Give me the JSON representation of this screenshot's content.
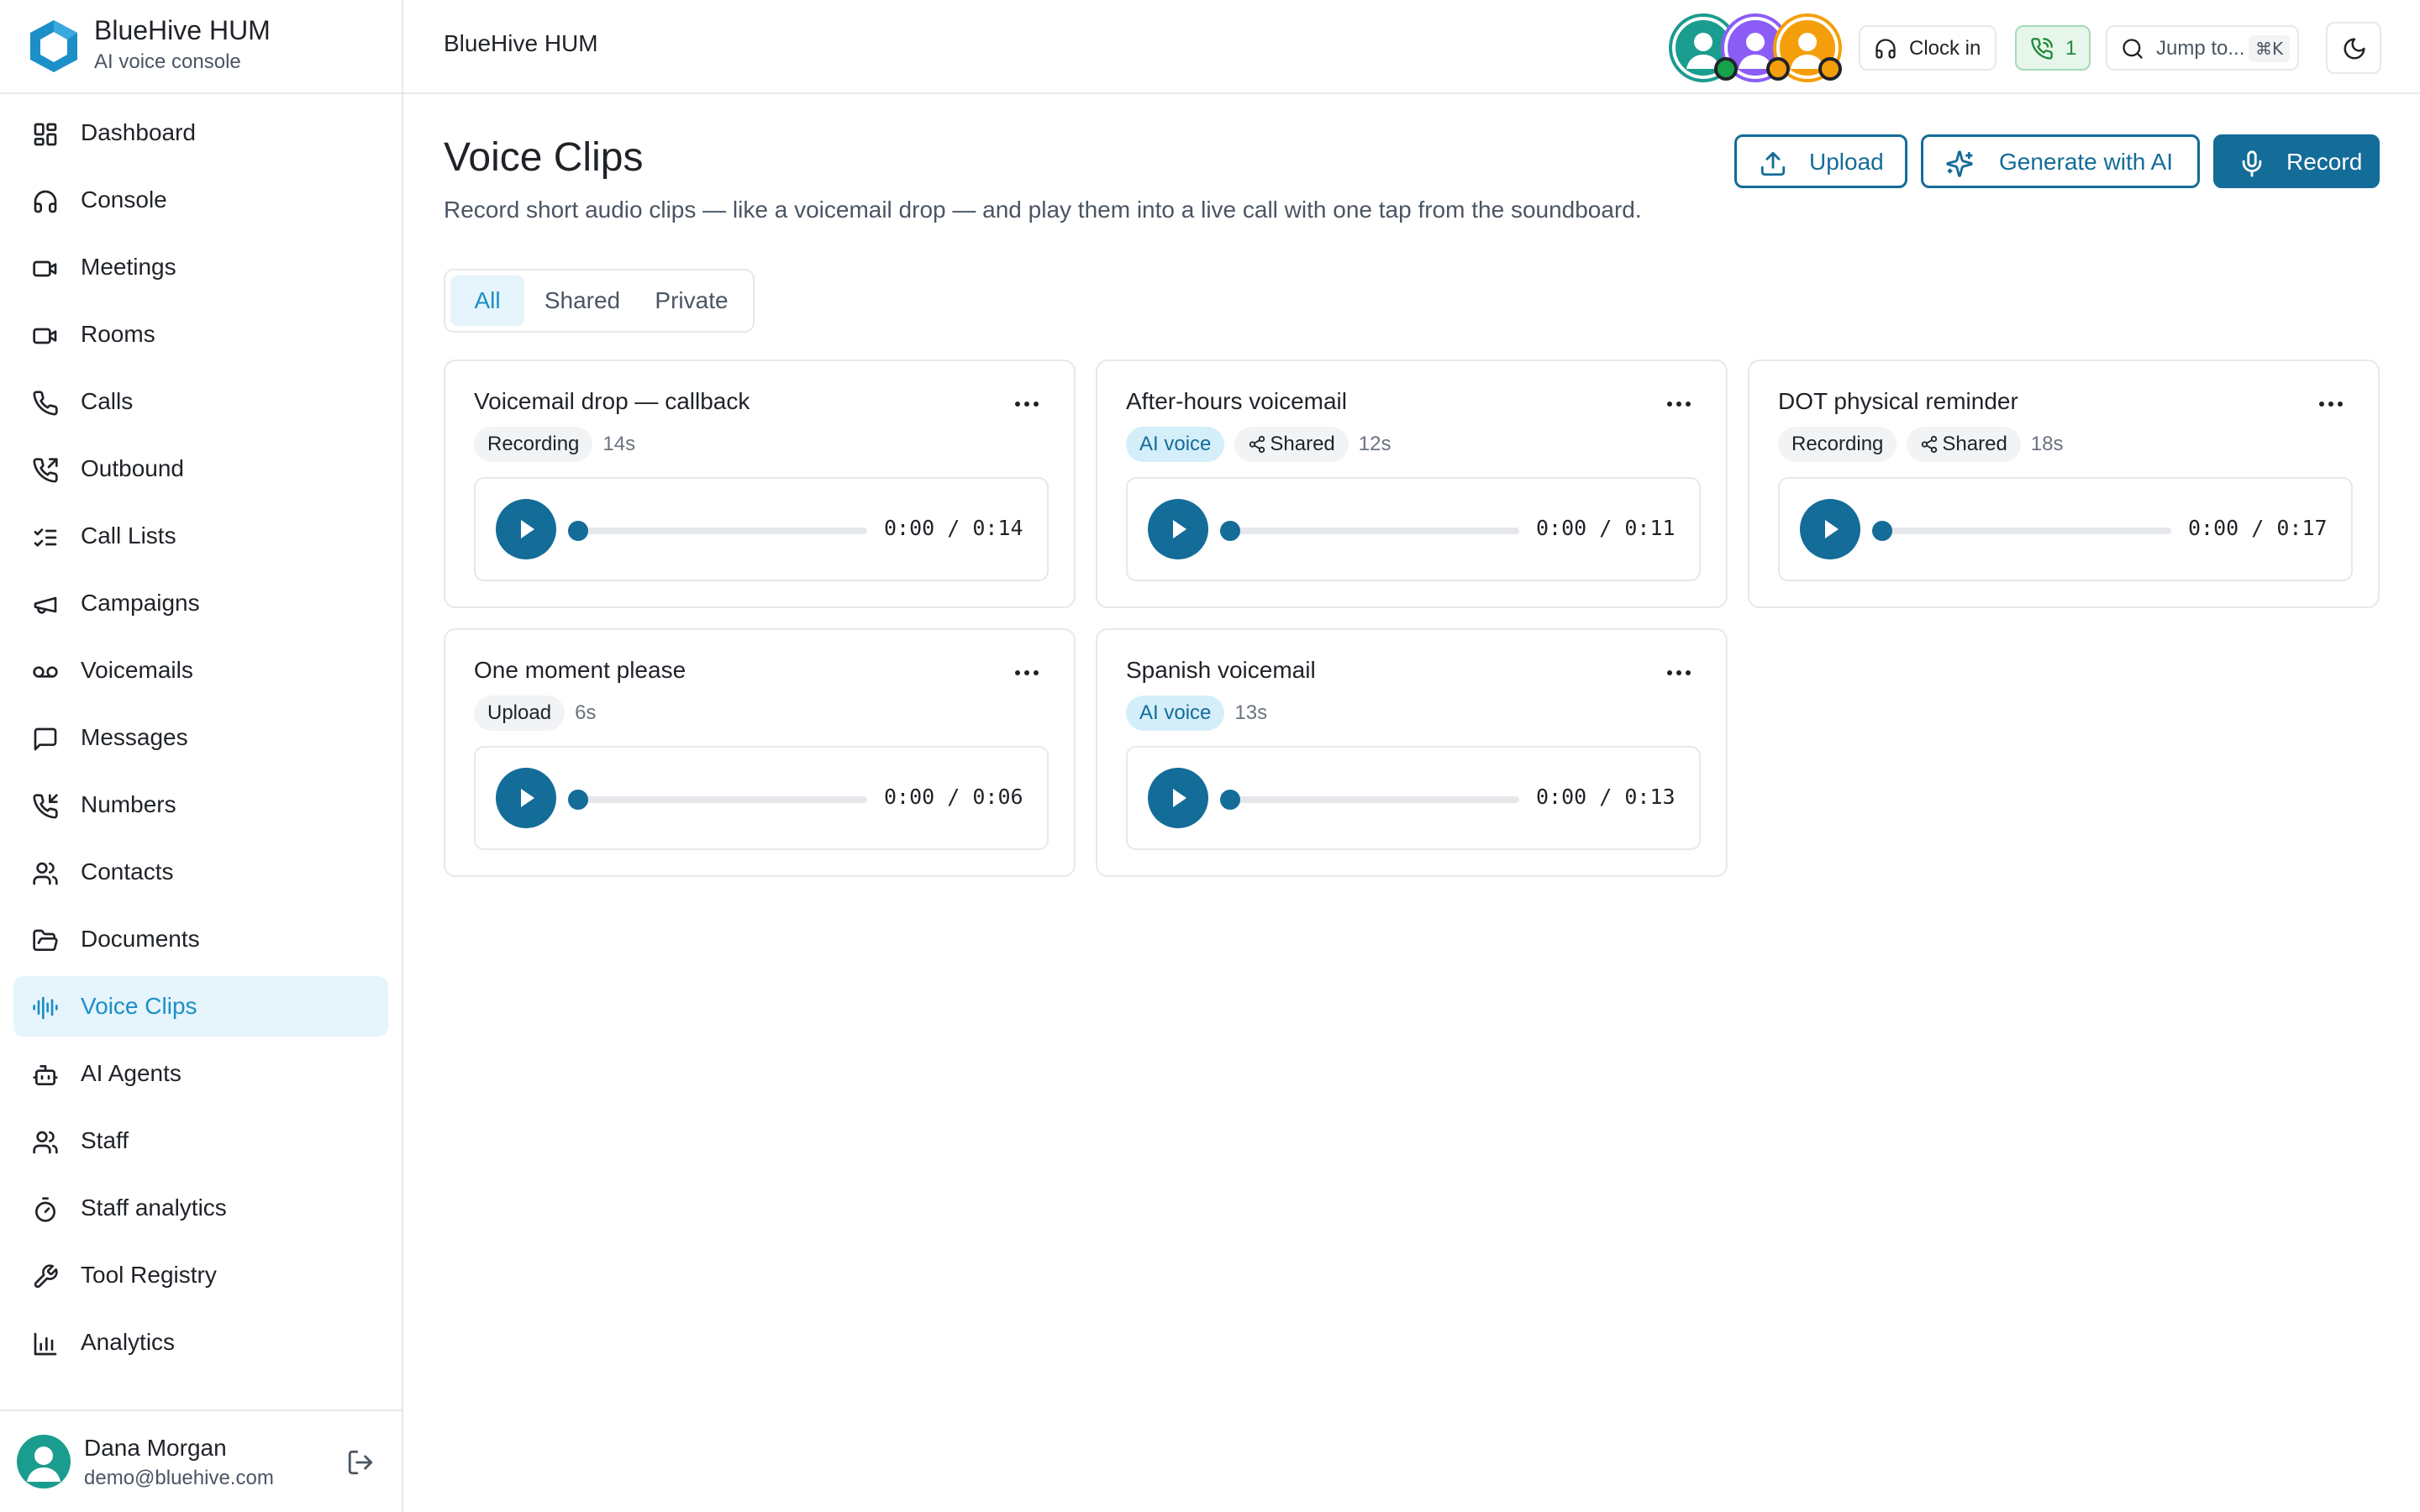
{
  "brand": {
    "name": "BlueHive HUM",
    "tagline": "AI voice console"
  },
  "sidebar": {
    "items": [
      {
        "label": "Dashboard",
        "icon": "dashboard-icon"
      },
      {
        "label": "Console",
        "icon": "headphones-icon"
      },
      {
        "label": "Meetings",
        "icon": "video-camera-icon"
      },
      {
        "label": "Rooms",
        "icon": "video-camera-icon"
      },
      {
        "label": "Calls",
        "icon": "phone-icon"
      },
      {
        "label": "Outbound",
        "icon": "phone-outgoing-icon"
      },
      {
        "label": "Call Lists",
        "icon": "list-checks-icon"
      },
      {
        "label": "Campaigns",
        "icon": "megaphone-icon"
      },
      {
        "label": "Voicemails",
        "icon": "voicemail-icon"
      },
      {
        "label": "Messages",
        "icon": "message-square-icon"
      },
      {
        "label": "Numbers",
        "icon": "phone-incoming-icon"
      },
      {
        "label": "Contacts",
        "icon": "users-icon"
      },
      {
        "label": "Documents",
        "icon": "folder-open-icon"
      },
      {
        "label": "Voice Clips",
        "icon": "audio-waveform-icon",
        "active": true
      },
      {
        "label": "AI Agents",
        "icon": "bot-icon"
      },
      {
        "label": "Staff",
        "icon": "users-icon"
      },
      {
        "label": "Staff analytics",
        "icon": "timer-icon"
      },
      {
        "label": "Tool Registry",
        "icon": "wrench-icon"
      },
      {
        "label": "Analytics",
        "icon": "bar-chart-icon"
      }
    ]
  },
  "user": {
    "name": "Dana Morgan",
    "email": "demo@bluehive.com"
  },
  "topbar": {
    "title": "BlueHive HUM",
    "clock_in": "Clock in",
    "active_calls": "1",
    "jump_placeholder": "Jump to...",
    "jump_shortcut": "⌘K"
  },
  "page": {
    "title": "Voice Clips",
    "description": "Record short audio clips — like a voicemail drop — and play them into a live call with one tap from the soundboard.",
    "actions": {
      "upload": "Upload",
      "generate": "Generate with AI",
      "record": "Record"
    },
    "tabs": [
      "All",
      "Shared",
      "Private"
    ],
    "active_tab": "All"
  },
  "clips": [
    {
      "title": "Voicemail drop — callback",
      "source": "Recording",
      "shared": false,
      "duration": "14s",
      "time": "0:00 / 0:14"
    },
    {
      "title": "After-hours voicemail",
      "source": "AI voice",
      "shared": true,
      "shared_label": "Shared",
      "duration": "12s",
      "time": "0:00 / 0:11"
    },
    {
      "title": "DOT physical reminder",
      "source": "Recording",
      "shared": true,
      "shared_label": "Shared",
      "duration": "18s",
      "time": "0:00 / 0:17"
    },
    {
      "title": "One moment please",
      "source": "Upload",
      "shared": false,
      "duration": "6s",
      "time": "0:00 / 0:06"
    },
    {
      "title": "Spanish voicemail",
      "source": "AI voice",
      "shared": false,
      "duration": "13s",
      "time": "0:00 / 0:13"
    }
  ],
  "colors": {
    "accent": "#146c98",
    "active_nav": "#1b8fc7",
    "active_bg": "#e6f4fb",
    "ai_badge": "#d4eefa",
    "calls_green": "#1f8a3a"
  }
}
